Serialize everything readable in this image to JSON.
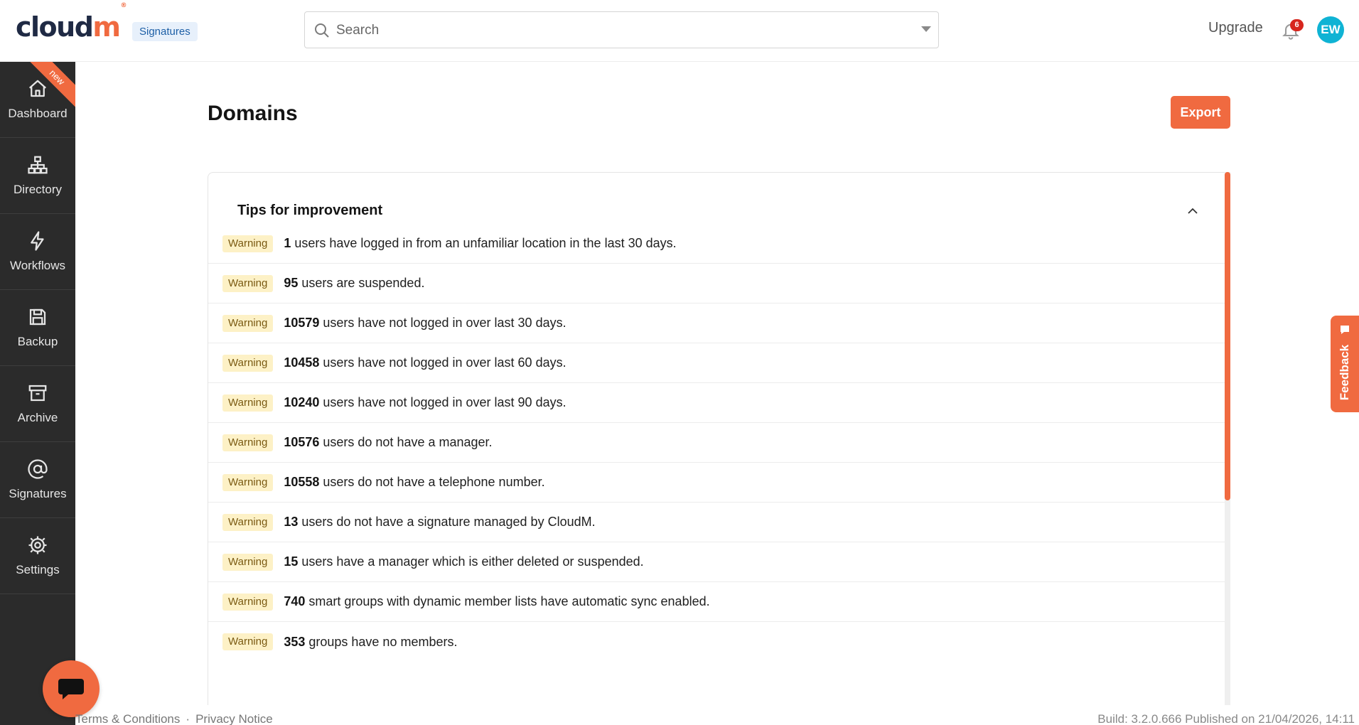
{
  "header": {
    "logo_text_dark": "cloud",
    "logo_text_accent": "m",
    "logo_mark": "®",
    "product_badge": "Signatures",
    "search_placeholder": "Search",
    "upgrade_label": "Upgrade",
    "notification_count": "6",
    "avatar_initials": "EW"
  },
  "sidebar": {
    "items": [
      {
        "label": "Dashboard",
        "icon": "home-icon",
        "ribbon": "new"
      },
      {
        "label": "Directory",
        "icon": "sitemap-icon"
      },
      {
        "label": "Workflows",
        "icon": "lightning-icon"
      },
      {
        "label": "Backup",
        "icon": "floppy-disk-icon"
      },
      {
        "label": "Archive",
        "icon": "archive-box-icon"
      },
      {
        "label": "Signatures",
        "icon": "at-sign-icon"
      },
      {
        "label": "Settings",
        "icon": "gear-icon"
      }
    ]
  },
  "main": {
    "title": "Domains",
    "export_label": "Export",
    "panel": {
      "title": "Tips for improvement",
      "tips": [
        {
          "badge": "Warning",
          "count": "1",
          "text": "users have logged in from an unfamiliar location in the last 30 days."
        },
        {
          "badge": "Warning",
          "count": "95",
          "text": "users are suspended."
        },
        {
          "badge": "Warning",
          "count": "10579",
          "text": "users have not logged in over last 30 days."
        },
        {
          "badge": "Warning",
          "count": "10458",
          "text": "users have not logged in over last 60 days."
        },
        {
          "badge": "Warning",
          "count": "10240",
          "text": "users have not logged in over last 90 days."
        },
        {
          "badge": "Warning",
          "count": "10576",
          "text": "users do not have a manager."
        },
        {
          "badge": "Warning",
          "count": "10558",
          "text": "users do not have a telephone number."
        },
        {
          "badge": "Warning",
          "count": "13",
          "text": "users do not have a signature managed by CloudM."
        },
        {
          "badge": "Warning",
          "count": "15",
          "text": "users have a manager which is either deleted or suspended."
        },
        {
          "badge": "Warning",
          "count": "740",
          "text": "smart groups with dynamic member lists have automatic sync enabled."
        },
        {
          "badge": "Warning",
          "count": "353",
          "text": "groups have no members."
        }
      ]
    }
  },
  "feedback_label": "Feedback",
  "footer": {
    "terms": "Terms & Conditions",
    "separator": "·",
    "privacy": "Privacy Notice",
    "build": "Build: 3.2.0.666 Published on 21/04/2026, 14:11"
  },
  "colors": {
    "accent": "#f06a40",
    "sidebar_bg": "#2b2b2b",
    "warning_bg": "#fdf1c6",
    "avatar_bg": "#0fb3d4",
    "notification_badge": "#d7261e"
  }
}
